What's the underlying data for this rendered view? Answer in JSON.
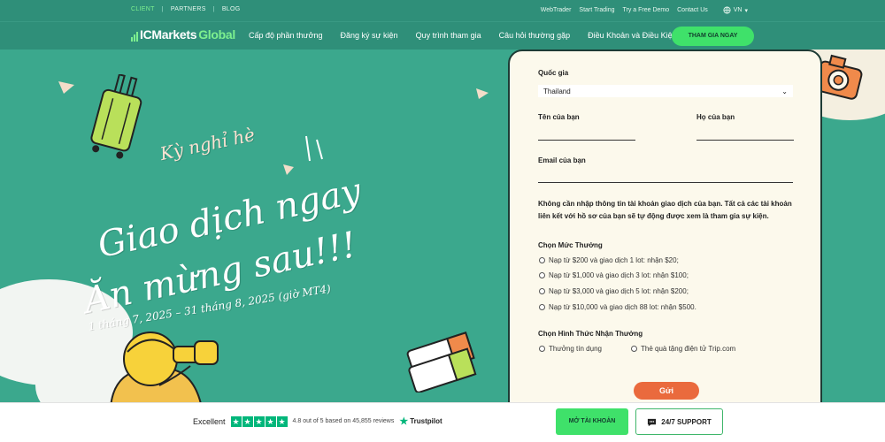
{
  "topbar": {
    "links": [
      "CLIENT",
      "PARTNERS",
      "BLOG"
    ],
    "right_links": [
      "WebTrader",
      "Start Trading",
      "Try a Free Demo",
      "Contact Us"
    ],
    "lang": "VN"
  },
  "navbar": {
    "logo_main": "ICMarkets",
    "logo_accent": "Global",
    "items": [
      "Cấp độ phần thưởng",
      "Đăng ký sự kiện",
      "Quy trình tham gia",
      "Câu hỏi thường gặp",
      "Điều Khoản và Điều Kiện"
    ],
    "cta": "THAM GIA NGAY"
  },
  "hero": {
    "line1": "Kỳ nghỉ hè",
    "line2": "Giao dịch ngay",
    "line3": "Ăn mừng sau!!!",
    "dates": "1 tháng 7, 2025 – 31 tháng 8, 2025 (giờ MT4)"
  },
  "form": {
    "country_label": "Quốc gia",
    "country_value": "Thailand",
    "first_name_label": "Tên của bạn",
    "last_name_label": "Họ của bạn",
    "email_label": "Email của bạn",
    "note": "Không cần nhập thông tin tài khoản giao dịch của bạn. Tất cả các tài khoản liên kết với hồ sơ của bạn sẽ tự động được xem là tham gia sự kiện.",
    "reward_level_label": "Chọn Mức Thưởng",
    "reward_levels": [
      "Nạp từ $200 và giao dịch 1 lot: nhận $20;",
      "Nạp từ $1,000 và giao dịch 3 lot: nhận $100;",
      "Nạp từ $3,000 và giao dịch 5 lot: nhận $200;",
      "Nạp từ $10,000 và giao dịch 88 lot: nhận $500."
    ],
    "reward_method_label": "Chọn Hình Thức Nhận Thưởng",
    "reward_methods": [
      "Thưởng tín dụng",
      "Thẻ quà tặng điện tử Trip.com"
    ],
    "submit": "Gửi"
  },
  "bottom": {
    "rating_word": "Excellent",
    "rating_text": "4.8 out of 5 based on 45,855 reviews",
    "trustpilot": "Trustpilot",
    "open_account": "MỞ TÀI KHOẢN",
    "support": "24/7 SUPPORT"
  },
  "colors": {
    "background": "#3aa48a",
    "accent_green": "#3fe16a",
    "submit_orange": "#ea6a3d",
    "panel": "#fcf9ec",
    "trustpilot_green": "#00b67a"
  }
}
